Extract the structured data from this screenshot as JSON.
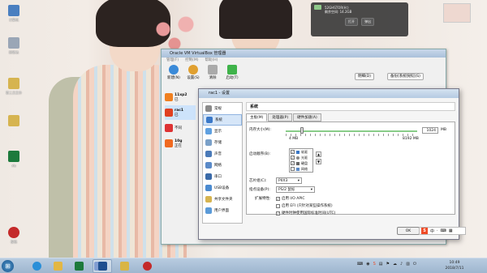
{
  "desktop": {
    "icons": [
      {
        "label": "计算机",
        "color": "#4a7fc0"
      },
      {
        "label": "回收站",
        "color": "#9aa6b6"
      },
      {
        "label": "第三方文件",
        "color": "#d6b450"
      },
      {
        "label": "",
        "color": "#d6b450"
      },
      {
        "label": "xls",
        "color": "#1d7a3c"
      },
      {
        "label": "樱桃",
        "color": "#c42a2a"
      }
    ]
  },
  "gadget": {
    "line1": "52GHSTOR(H:)",
    "line2": "剩余空间: 14.2GB",
    "btn_open": "打开",
    "btn_eject": "弹出"
  },
  "manager": {
    "title": "Oracle VM VirtualBox 管理器",
    "menu": [
      "管理(F)",
      "控制(M)",
      "帮助(H)"
    ],
    "toolbar": [
      {
        "label": "新建(N)",
        "color": "#3a8ad8"
      },
      {
        "label": "设置(S)",
        "color": "#e0a030"
      },
      {
        "label": "清除",
        "color": "#aaaaaa"
      },
      {
        "label": "启动(T)",
        "color": "#3fb34a"
      }
    ],
    "seg_detail": "明细(D)",
    "seg_snapshot": "备份[系统快照](S)",
    "vms": [
      {
        "name": "11xp2",
        "state": "已"
      },
      {
        "name": "rac1",
        "state": "已"
      },
      {
        "name": "不同",
        "state": ""
      },
      {
        "name": "10g",
        "state": "正在"
      }
    ]
  },
  "dialog": {
    "title": "rac1 - 设置",
    "sidebar": [
      {
        "label": "常规",
        "selected": false
      },
      {
        "label": "系统",
        "selected": true
      },
      {
        "label": "显示",
        "selected": false
      },
      {
        "label": "存储",
        "selected": false
      },
      {
        "label": "声音",
        "selected": false
      },
      {
        "label": "网络",
        "selected": false
      },
      {
        "label": "串口",
        "selected": false
      },
      {
        "label": "USB设备",
        "selected": false
      },
      {
        "label": "共享文件夹",
        "selected": false
      },
      {
        "label": "用户界面",
        "selected": false
      }
    ],
    "header": "系统",
    "tabs": [
      "主板(M)",
      "处理器(P)",
      "硬件加速(A)"
    ],
    "memory_label": "内存大小(M):",
    "memory_value": "1024",
    "memory_unit": "MB",
    "memory_min": "4 MB",
    "memory_max": "8192 MB",
    "memory_fraction": 0.125,
    "boot_label": "启动顺序(B):",
    "boot_items": [
      {
        "label": "软驱",
        "checked": true
      },
      {
        "label": "光驱",
        "checked": true
      },
      {
        "label": "硬盘",
        "checked": true
      },
      {
        "label": "网络",
        "checked": false
      }
    ],
    "chipset_label": "芯片组(C):",
    "chipset_value": "PIIX3",
    "pointing_label": "指点设备(P):",
    "pointing_value": "PS/2 鼠标",
    "ext_label": "扩展特性:",
    "ext_items": [
      {
        "label": "启用 I/O APIC",
        "checked": true
      },
      {
        "label": "启用 EFI (只针对某些操作系统)",
        "checked": false
      },
      {
        "label": "硬件时钟使用国际标准时间(UTC)",
        "checked": true
      }
    ],
    "ok": "OK"
  },
  "ime": {
    "label": "中",
    "extra": "·"
  },
  "taskbar": {
    "apps": [
      {
        "name": "ie",
        "color": "#2a8fd8"
      },
      {
        "name": "explorer",
        "color": "#e3b744"
      },
      {
        "name": "excel",
        "color": "#1d7a3c"
      },
      {
        "name": "word",
        "color": "#2f5eb5"
      },
      {
        "name": "virtualbox",
        "color": "#1f4f8f"
      },
      {
        "name": "folder",
        "color": "#d9b545"
      },
      {
        "name": "cherry",
        "color": "#c42a2a"
      }
    ],
    "time": "10:49",
    "date": "2018/7/11"
  }
}
